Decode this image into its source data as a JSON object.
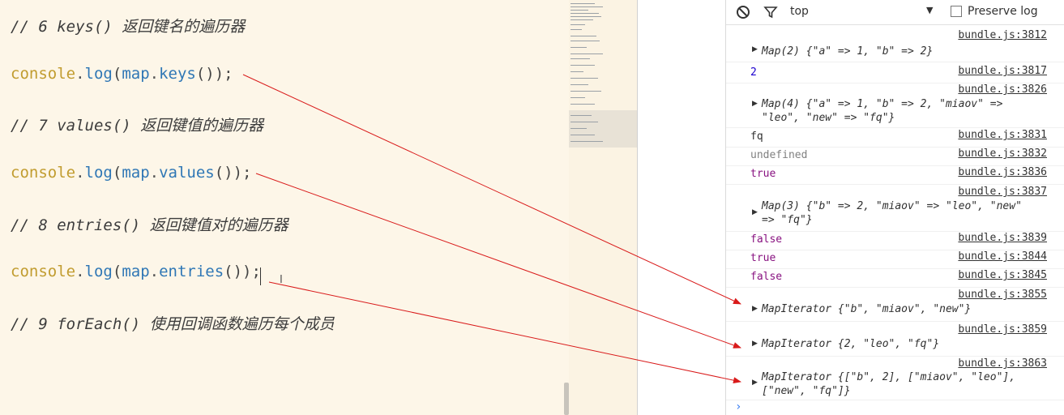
{
  "editor": {
    "lines": [
      {
        "comment": "// 6 keys() 返回键名的遍历器"
      },
      {
        "obj": "console",
        "method": "log",
        "arg": "map",
        "argm": "keys",
        "tail": "());"
      },
      {
        "comment": "// 7 values() 返回键值的遍历器"
      },
      {
        "obj": "console",
        "method": "log",
        "arg": "map",
        "argm": "values",
        "tail": "());"
      },
      {
        "comment": "// 8 entries() 返回键值对的遍历器"
      },
      {
        "obj": "console",
        "method": "log",
        "arg": "map",
        "argm": "entries",
        "tail": "());"
      },
      {
        "comment": "// 9 forEach() 使用回调函数遍历每个成员"
      }
    ]
  },
  "console": {
    "toolbar": {
      "context": "top",
      "preserve_log": "Preserve log",
      "clear_icon": "block-icon",
      "filter_icon": "filter-icon"
    },
    "messages": [
      {
        "src": "bundle.js:3812",
        "text1": "Map(2) {\"a\" => 1, \"b\" => 2}",
        "text2": ""
      },
      {
        "src": "bundle.js:3817",
        "text1": "2",
        "text2": ""
      },
      {
        "src": "bundle.js:3826",
        "text1": "Map(4) {\"a\" => 1, \"b\" => 2, \"miaov\" =>",
        "text2": "\"leo\", \"new\" => \"fq\"}"
      },
      {
        "src": "bundle.js:3831",
        "text1": "fq",
        "text2": ""
      },
      {
        "src": "bundle.js:3832",
        "text1": "undefined",
        "text2": ""
      },
      {
        "src": "bundle.js:3836",
        "text1": "true",
        "text2": ""
      },
      {
        "src": "bundle.js:3837",
        "text1": "Map(3) {\"b\" => 2, \"miaov\" => \"leo\", \"new\"",
        "text2": "=> \"fq\"}"
      },
      {
        "src": "bundle.js:3839",
        "text1": "false",
        "text2": ""
      },
      {
        "src": "bundle.js:3844",
        "text1": "true",
        "text2": ""
      },
      {
        "src": "bundle.js:3845",
        "text1": "false",
        "text2": ""
      },
      {
        "src": "bundle.js:3855",
        "text1": "MapIterator {\"b\", \"miaov\", \"new\"}",
        "text2": ""
      },
      {
        "src": "bundle.js:3859",
        "text1": "MapIterator {2, \"leo\", \"fq\"}",
        "text2": ""
      },
      {
        "src": "bundle.js:3863",
        "text1": "MapIterator {[\"b\", 2], [\"miaov\", \"leo\"],",
        "text2": "[\"new\", \"fq\"]}"
      }
    ],
    "prompt": "›"
  },
  "colors": {
    "annotation_arrow": "#d91a1a",
    "editor_bg": "#fdf6e8"
  }
}
